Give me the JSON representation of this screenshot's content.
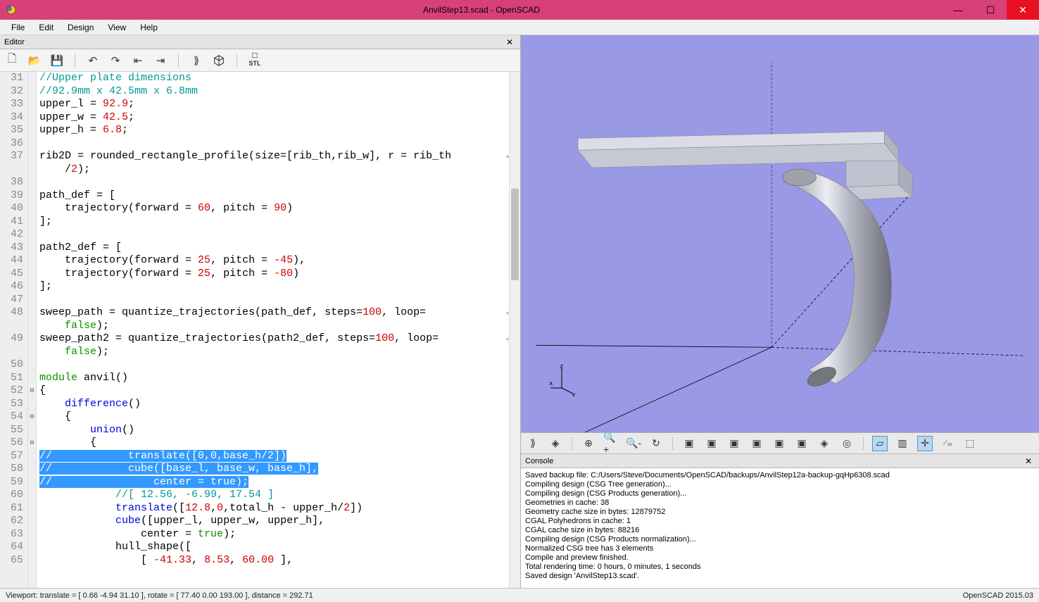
{
  "window": {
    "title": "AnvilStep13.scad - OpenSCAD"
  },
  "menu": [
    "File",
    "Edit",
    "Design",
    "View",
    "Help"
  ],
  "editor": {
    "panel_title": "Editor"
  },
  "code_lines": [
    {
      "n": 31,
      "html": "<span class='c-comment'>//Upper plate dimensions</span>"
    },
    {
      "n": 32,
      "html": "<span class='c-comment'>//92.9mm x 42.5mm x 6.8mm</span>"
    },
    {
      "n": 33,
      "html": "upper_l = <span class='c-num'>92.9</span>;"
    },
    {
      "n": 34,
      "html": "upper_w = <span class='c-num'>42.5</span>;"
    },
    {
      "n": 35,
      "html": "upper_h = <span class='c-num'>6.8</span>;"
    },
    {
      "n": 36,
      "html": ""
    },
    {
      "n": 37,
      "html": "rib2D = rounded_rectangle_profile(size=[rib_th,rib_w], r = rib_th <span class='wrap-arrow'>↲</span>"
    },
    {
      "n": "",
      "html": "    /<span class='c-num'>2</span>);"
    },
    {
      "n": 38,
      "html": ""
    },
    {
      "n": 39,
      "html": "path_def = ["
    },
    {
      "n": 40,
      "html": "    trajectory(forward = <span class='c-num'>60</span>, pitch = <span class='c-num'>90</span>)"
    },
    {
      "n": 41,
      "html": "];"
    },
    {
      "n": 42,
      "html": ""
    },
    {
      "n": 43,
      "html": "path2_def = ["
    },
    {
      "n": 44,
      "html": "    trajectory(forward = <span class='c-num'>25</span>, pitch = <span class='c-num'>-45</span>),"
    },
    {
      "n": 45,
      "html": "    trajectory(forward = <span class='c-num'>25</span>, pitch = <span class='c-num'>-80</span>)"
    },
    {
      "n": 46,
      "html": "];"
    },
    {
      "n": 47,
      "html": ""
    },
    {
      "n": 48,
      "html": "sweep_path = quantize_trajectories(path_def, steps=<span class='c-num'>100</span>, loop=<span class='wrap-arrow'>↲</span>"
    },
    {
      "n": "",
      "html": "    <span class='c-kw'>false</span>);"
    },
    {
      "n": 49,
      "html": "sweep_path2 = quantize_trajectories(path2_def, steps=<span class='c-num'>100</span>, loop=<span class='wrap-arrow'>↲</span>"
    },
    {
      "n": "",
      "html": "    <span class='c-kw'>false</span>);"
    },
    {
      "n": 50,
      "html": ""
    },
    {
      "n": 51,
      "html": "<span class='c-kw'>module</span> anvil()"
    },
    {
      "n": 52,
      "html": "{",
      "fold": "⊟"
    },
    {
      "n": 53,
      "html": "    <span class='c-builtin'>difference</span>()"
    },
    {
      "n": 54,
      "html": "    {",
      "fold": "⊟"
    },
    {
      "n": 55,
      "html": "        <span class='c-builtin'>union</span>()"
    },
    {
      "n": 56,
      "html": "        {",
      "fold": "⊟"
    },
    {
      "n": 57,
      "html": "<span class='sel'>//            translate([0,0,base_h/2])</span>",
      "selected": true
    },
    {
      "n": 58,
      "html": "<span class='sel'>//            cube([base_l, base_w, base_h],</span>",
      "selected": true
    },
    {
      "n": 59,
      "html": "<span class='sel'>//                center = true);</span>",
      "selected": true
    },
    {
      "n": 60,
      "html": "            <span class='c-comment'>//[ 12.56, -6.99, 17.54 ]</span>"
    },
    {
      "n": 61,
      "html": "            <span class='c-builtin'>translate</span>([<span class='c-num'>12.8</span>,<span class='c-num'>0</span>,total_h - upper_h/<span class='c-num'>2</span>])"
    },
    {
      "n": 62,
      "html": "            <span class='c-builtin'>cube</span>([upper_l, upper_w, upper_h],"
    },
    {
      "n": 63,
      "html": "                center = <span class='c-kw'>true</span>);"
    },
    {
      "n": 64,
      "html": "            hull_shape(["
    },
    {
      "n": 65,
      "html": "                [ <span class='c-num'>-41.33</span>, <span class='c-num'>8.53</span>, <span class='c-num'>60.00</span> ],"
    }
  ],
  "console": {
    "panel_title": "Console",
    "lines": [
      "Saved backup file: C:/Users/Steve/Documents/OpenSCAD/backups/AnvilStep12a-backup-gqHp6308.scad",
      "Compiling design (CSG Tree generation)...",
      "Compiling design (CSG Products generation)...",
      "Geometries in cache: 38",
      "Geometry cache size in bytes: 12879752",
      "CGAL Polyhedrons in cache: 1",
      "CGAL cache size in bytes: 88216",
      "Compiling design (CSG Products normalization)...",
      "Normalized CSG tree has 3 elements",
      "Compile and preview finished.",
      "Total rendering time: 0 hours, 0 minutes, 1 seconds",
      "Saved design 'AnvilStep13.scad'."
    ]
  },
  "status": {
    "left": "Viewport: translate = [ 0.66 -4.94 31.10 ], rotate = [ 77.40 0.00 193.00 ], distance = 292.71",
    "right": "OpenSCAD 2015.03"
  }
}
